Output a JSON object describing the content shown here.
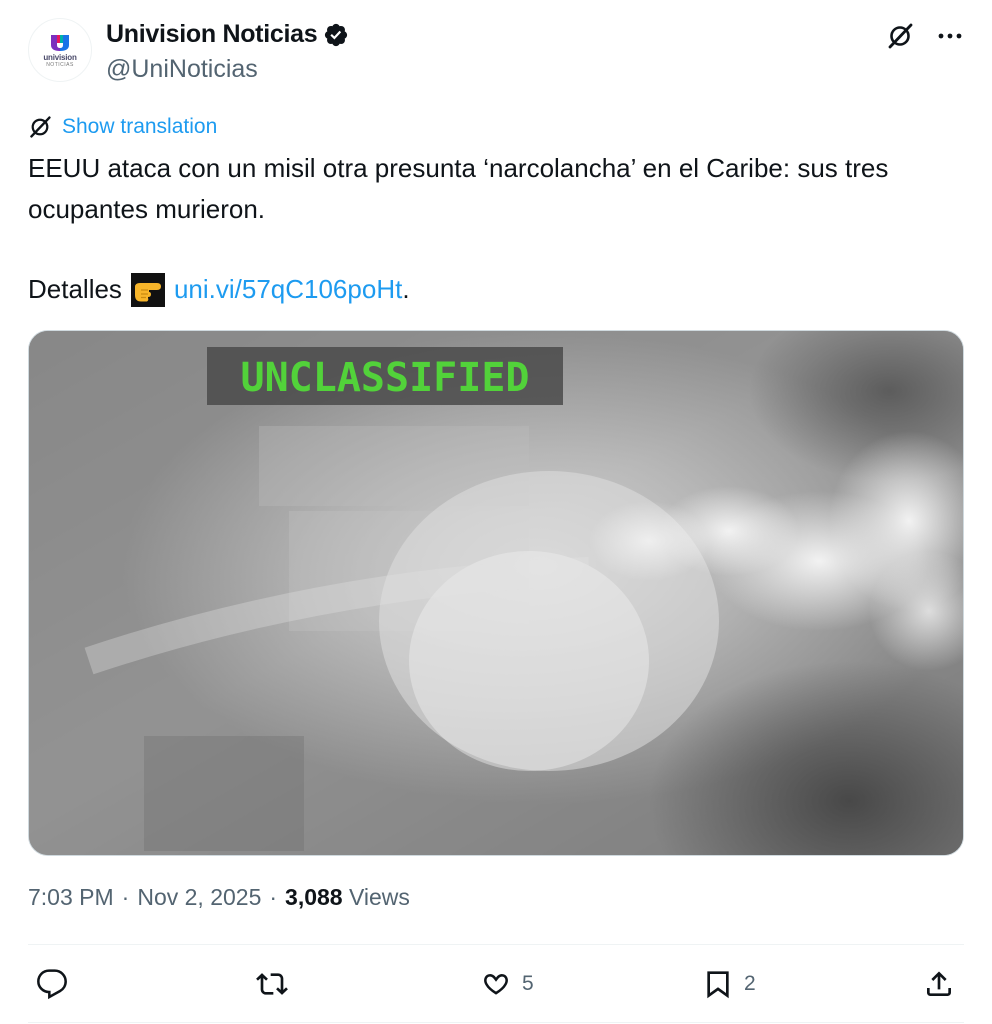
{
  "author": {
    "avatar_text": "univision",
    "avatar_subtext": "NOTICIAS",
    "display_name": "Univision Noticias",
    "handle": "@UniNoticias",
    "verified_icon": "verified-badge-icon"
  },
  "header_actions": {
    "grok_icon": "grok-icon",
    "more_icon": "more-icon"
  },
  "translation": {
    "label": "Show translation"
  },
  "tweet": {
    "text_line": "EEUU ataca con un misil otra presunta ‘narcolancha’ en el Caribe: sus tres ocupantes murieron.",
    "details_label": "Detalles",
    "details_emoji": "pointing-right-emoji",
    "link_text": "uni.vi/57qC106poHt",
    "link_suffix": "."
  },
  "media": {
    "overlay_text": "UNCLASSIFIED"
  },
  "meta": {
    "time": "7:03 PM",
    "sep1": "·",
    "date": "Nov 2, 2025",
    "sep2": "·",
    "views_count": "3,088",
    "views_label": "Views"
  },
  "actions": {
    "reply_count": "",
    "retweet_count": "",
    "like_count": "5",
    "bookmark_count": "2"
  },
  "colors": {
    "accent": "#1d9bf0",
    "text": "#0f1419",
    "secondary": "#536471",
    "overlay_green": "#52d23a"
  }
}
